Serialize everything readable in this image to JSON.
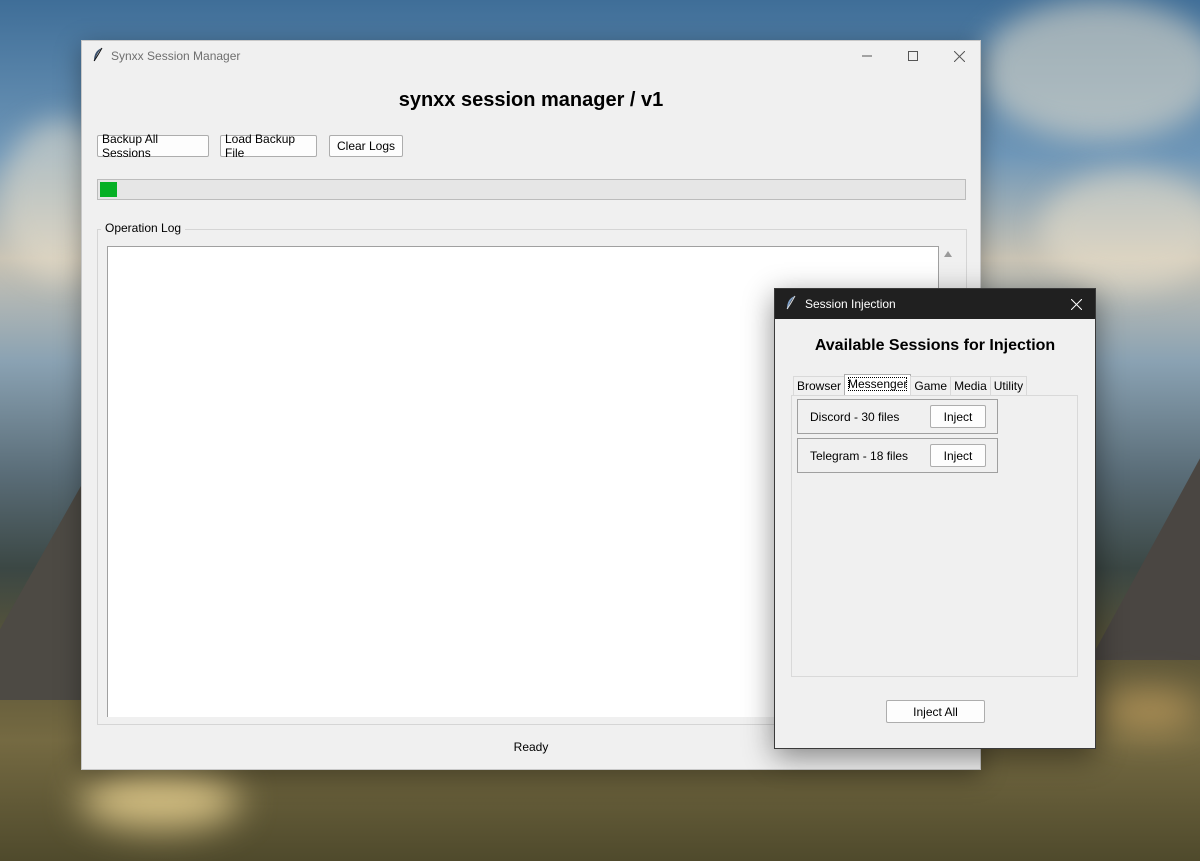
{
  "main_window": {
    "title": "Synxx Session Manager",
    "heading": "synxx session manager / v1",
    "toolbar": {
      "backup_all": "Backup All Sessions",
      "load_backup": "Load Backup File",
      "clear_logs": "Clear Logs"
    },
    "progress": {
      "value_percent": 2,
      "color": "#06b025"
    },
    "log": {
      "label": "Operation Log",
      "content": ""
    },
    "status": "Ready"
  },
  "dialog": {
    "title": "Session Injection",
    "heading": "Available Sessions for Injection",
    "tabs": [
      {
        "label": "Browser",
        "active": false
      },
      {
        "label": "Messenger",
        "active": true
      },
      {
        "label": "Game",
        "active": false
      },
      {
        "label": "Media",
        "active": false
      },
      {
        "label": "Utility",
        "active": false
      }
    ],
    "sessions": [
      {
        "label": "Discord - 30 files",
        "button": "Inject"
      },
      {
        "label": "Telegram - 18 files",
        "button": "Inject"
      }
    ],
    "inject_all": "Inject All"
  },
  "icons": {
    "app": "feather-icon",
    "minimize": "minimize-icon",
    "maximize": "maximize-icon",
    "close": "close-icon",
    "scroll_up": "scroll-up-arrow-icon"
  }
}
